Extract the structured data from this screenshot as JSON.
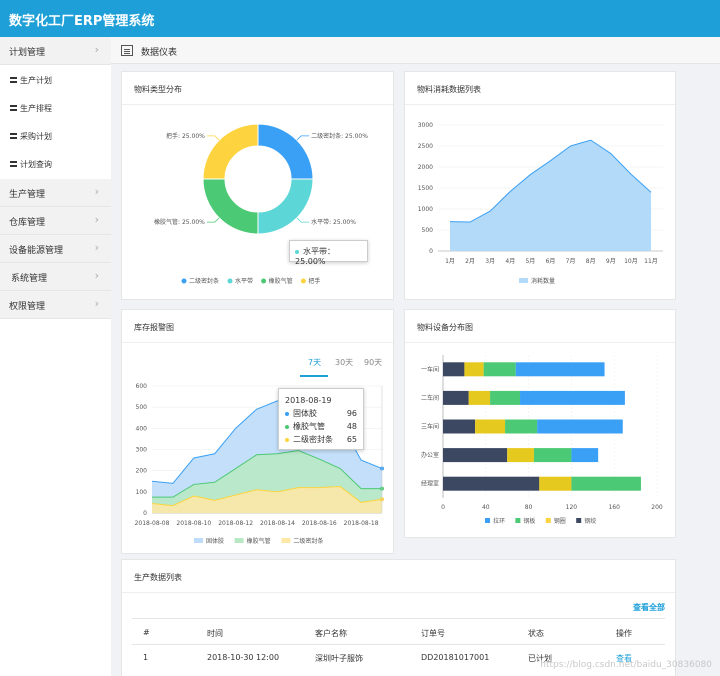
{
  "app": {
    "title": "数字化工厂ERP管理系统"
  },
  "sidebar": {
    "groups": [
      {
        "label": "计划管理",
        "sub": [
          "生产计划",
          "生产排程",
          "采购计划",
          "计划查询"
        ]
      },
      {
        "label": "生产管理"
      },
      {
        "label": "仓库管理"
      },
      {
        "label": "设备能源管理"
      },
      {
        "label": "系统管理"
      },
      {
        "label": "权限管理"
      }
    ]
  },
  "page": {
    "title": "数据仪表"
  },
  "panels": {
    "pie": {
      "title": "物料类型分布"
    },
    "area": {
      "title": "物料消耗数据列表"
    },
    "stock": {
      "title": "库存报警图",
      "tabs": [
        "7天",
        "30天",
        "90天"
      ]
    },
    "hbar": {
      "title": "物料设备分布图"
    },
    "table": {
      "title": "生产数据列表",
      "view_all": "查看全部"
    }
  },
  "pie_tooltip": "水平带：25.00%",
  "stock_tooltip": {
    "date": "2018-08-19",
    "rows": [
      {
        "name": "固体胶",
        "value": "96"
      },
      {
        "name": "橡胶气管",
        "value": "48"
      },
      {
        "name": "二级密封条",
        "value": "65"
      }
    ]
  },
  "table": {
    "headers": [
      "#",
      "时间",
      "客户名称",
      "订单号",
      "状态",
      "操作"
    ],
    "rows": [
      {
        "idx": "1",
        "time": "2018-10-30  12:00",
        "customer": "深圳叶子服饰",
        "order": "DD20181017001",
        "status": "已计划",
        "action": "查看"
      }
    ]
  },
  "watermark": "https://blog.csdn.net/baidu_30836080",
  "chart_data": [
    {
      "type": "pie",
      "categories": [
        "二级密封条",
        "水平带",
        "橡胶气管",
        "把手"
      ],
      "values": [
        25,
        25,
        25,
        25
      ],
      "labels": [
        "二级密封条: 25.00%",
        "水平带: 25.00%",
        "橡胶气管: 25.00%",
        "把手: 25.00%"
      ],
      "colors": [
        "#3aa0f5",
        "#5cd6d6",
        "#4cc974",
        "#fdd440"
      ],
      "legend": "bottom"
    },
    {
      "type": "area",
      "x": [
        "1月",
        "2月",
        "3月",
        "4月",
        "5月",
        "6月",
        "7月",
        "8月",
        "9月",
        "10月",
        "11月"
      ],
      "series": [
        {
          "name": "消耗数量",
          "values": [
            700,
            690,
            950,
            1420,
            1820,
            2150,
            2500,
            2640,
            2320,
            1830,
            1400
          ]
        }
      ],
      "ylim": [
        0,
        3000
      ],
      "yticks": [
        0,
        500,
        1000,
        1500,
        2000,
        2500,
        3000
      ],
      "legend": "bottom",
      "colors": [
        "#3aa0f5"
      ]
    },
    {
      "type": "area",
      "x": [
        "2018-08-08",
        "2018-08-09",
        "2018-08-10",
        "2018-08-11",
        "2018-08-12",
        "2018-08-13",
        "2018-08-14",
        "2018-08-15",
        "2018-08-16",
        "2018-08-17",
        "2018-08-18",
        "2018-08-19"
      ],
      "xticks": [
        "2018-08-08",
        "2018-08-10",
        "2018-08-12",
        "2018-08-14",
        "2018-08-16",
        "2018-08-18"
      ],
      "series": [
        {
          "name": "固体胶",
          "values": [
            150,
            140,
            260,
            280,
            400,
            490,
            530,
            480,
            470,
            430,
            250,
            210
          ]
        },
        {
          "name": "橡胶气管",
          "values": [
            75,
            75,
            135,
            145,
            210,
            275,
            280,
            295,
            255,
            210,
            115,
            115
          ]
        },
        {
          "name": "二级密封条",
          "values": [
            45,
            35,
            80,
            60,
            85,
            110,
            100,
            120,
            120,
            125,
            50,
            65
          ]
        }
      ],
      "ylim": [
        0,
        600
      ],
      "yticks": [
        0,
        100,
        200,
        300,
        400,
        500,
        600
      ],
      "legend": "bottom",
      "colors": [
        "#3aa0f5",
        "#4cc974",
        "#fdd440"
      ]
    },
    {
      "type": "bar",
      "orientation": "horizontal",
      "stacked": true,
      "categories": [
        "一车间",
        "二车间",
        "三车间",
        "办公室",
        "经理室"
      ],
      "series": [
        {
          "name": "拉环",
          "values": [
            20,
            24,
            30,
            60,
            90
          ]
        },
        {
          "name": "钢板",
          "values": [
            18,
            20,
            28,
            25,
            30
          ]
        },
        {
          "name": "钢圈",
          "values": [
            30,
            28,
            30,
            35,
            65
          ]
        },
        {
          "name": "钢绞",
          "values": [
            83,
            98,
            80,
            25,
            0
          ]
        }
      ],
      "legend_labels": [
        "拉环",
        "钢板",
        "钢圈",
        "钢绞"
      ],
      "xlim": [
        0,
        200
      ],
      "xticks": [
        0,
        40,
        80,
        120,
        160,
        200
      ],
      "legend": "bottom",
      "colors": [
        "#3c4862",
        "#e5c91f",
        "#4cc974",
        "#3aa0f5"
      ],
      "legend_colors": [
        "#3aa0f5",
        "#4cc974",
        "#fdd440",
        "#3c4862"
      ]
    }
  ]
}
